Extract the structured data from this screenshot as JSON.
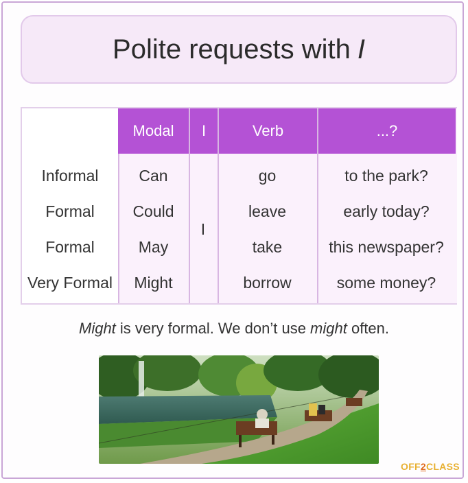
{
  "title": {
    "text": "Polite requests with",
    "emphasis": "I"
  },
  "table": {
    "headers": [
      "",
      "Modal",
      "I",
      "Verb",
      "...?"
    ],
    "rows": [
      {
        "register": "Informal",
        "modal": "Can",
        "verb": "go",
        "rest": "to the park?"
      },
      {
        "register": "Formal",
        "modal": "Could",
        "verb": "leave",
        "rest": "early today?"
      },
      {
        "register": "Formal",
        "modal": "May",
        "verb": "take",
        "rest": "this newspaper?"
      },
      {
        "register": "Very Formal",
        "modal": "Might",
        "verb": "borrow",
        "rest": "some money?"
      }
    ],
    "subject": "I"
  },
  "caption": {
    "part1": "Might",
    "part2": " is very formal. We don’t use ",
    "part3": "might",
    "part4": " often."
  },
  "logo": {
    "part1": "OFF",
    "part2": "2",
    "part3": "CLASS"
  },
  "colors": {
    "header": "#b452d5",
    "cell_bg": "#fbf1fc",
    "title_bg": "#f6e9f8"
  }
}
